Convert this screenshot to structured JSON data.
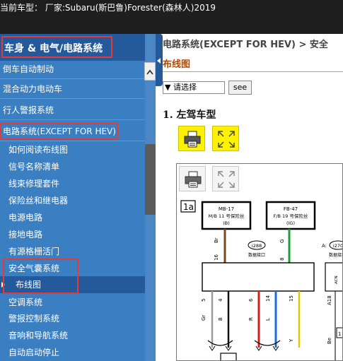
{
  "topbar": {
    "text": "当前车型： 厂家:Subaru(斯巴鲁)Forester(森林人)2019"
  },
  "sidebar": {
    "header": "车身 & 电气/电路系统",
    "items": [
      {
        "label": "倒车自动制动",
        "level": 0
      },
      {
        "label": "混合动力电动车",
        "level": 0
      },
      {
        "label": "行人警报系统",
        "level": 0
      },
      {
        "label": "电路系统(EXCEPT FOR HEV)",
        "level": 0
      },
      {
        "label": "如何阅读布线图",
        "level": 1
      },
      {
        "label": "信号名称清单",
        "level": 1
      },
      {
        "label": "线束修理套件",
        "level": 1
      },
      {
        "label": "保险丝和继电器",
        "level": 1
      },
      {
        "label": "电源电路",
        "level": 1
      },
      {
        "label": "接地电路",
        "level": 1
      },
      {
        "label": "有源格栅活门",
        "level": 1
      },
      {
        "label": "安全气囊系统",
        "level": 1
      },
      {
        "label": "布线图",
        "level": 2
      },
      {
        "label": "空调系统",
        "level": 1
      },
      {
        "label": "警报控制系统",
        "level": 1
      },
      {
        "label": "音响和导航系统",
        "level": 1
      },
      {
        "label": "自动启动停止",
        "level": 1
      }
    ]
  },
  "content": {
    "breadcrumb": "电路系统(EXCEPT FOR HEV) > 安全",
    "subtitle": "布线图",
    "select_value": "▼ 请选择",
    "select_arrow": "▼",
    "go_button": "see",
    "heading": "1. 左驾车型"
  },
  "diagram": {
    "tag": "1a",
    "fuse_left": {
      "line1": "MB-17",
      "line2": "M/B 11 号保险丝",
      "line3": "(B)"
    },
    "fuse_right": {
      "line1": "FB-47",
      "line2": "F/B 19 号保险丝",
      "line3": "(IG)"
    },
    "conn_left": {
      "id": "i288",
      "label": "数据接口"
    },
    "conn_right": {
      "id": "i270",
      "label": "数据接口",
      "prefix": "A:"
    },
    "wire_top_left": {
      "color": "Br",
      "pin": "16"
    },
    "wire_top_right": {
      "color": "G",
      "pin": "8"
    },
    "pins_bottom": [
      "5",
      "4",
      "6",
      "14",
      "15"
    ],
    "wire_colors_bottom": [
      "Gr",
      "B",
      "R",
      "L",
      "Y"
    ],
    "right_col": {
      "c1": "A18",
      "c2": "Be",
      "c3": "ACN"
    },
    "right_small": "1"
  },
  "colors": {
    "topbar": "#1e1e1e",
    "sidebar": "#3a7fc2",
    "sidebar_header": "#24599c",
    "highlight": "#e23b3b",
    "accent_orange": "#b34a00",
    "icon_yellow": "#fff200",
    "wire_brown": "#7b4a1e",
    "wire_green": "#1e9e3a",
    "wire_red": "#d3201a",
    "wire_blue": "#1b6fd0",
    "wire_yellow": "#e8c400"
  },
  "icons": [
    "print-icon",
    "fullscreen-icon"
  ]
}
